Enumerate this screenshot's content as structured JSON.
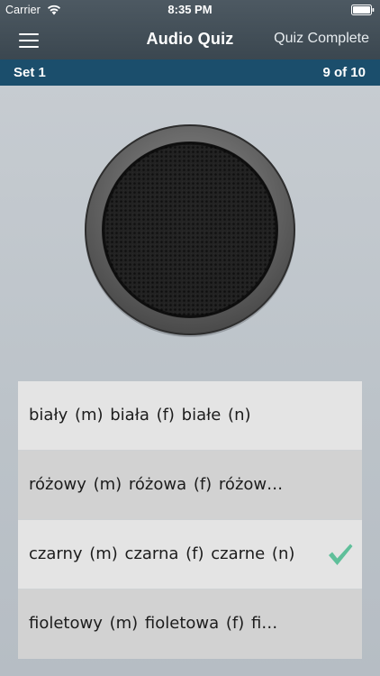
{
  "status_bar": {
    "carrier": "Carrier",
    "time": "8:35 PM",
    "icons": [
      "wifi-icon",
      "battery-icon"
    ]
  },
  "nav": {
    "title": "Audio Quiz",
    "right_button": "Quiz Complete",
    "left_icon": "hamburger-menu-icon"
  },
  "progress": {
    "set_label": "Set 1",
    "count_label": "9 of 10"
  },
  "speaker": {
    "icon": "speaker-grille-icon"
  },
  "answers": [
    {
      "text": "biały (m)  biała (f)  białe (n)",
      "correct": false
    },
    {
      "text": "różowy (m)  różowa (f)  różow…",
      "correct": false
    },
    {
      "text": "czarny (m)  czarna (f)  czarne (n)",
      "correct": true
    },
    {
      "text": "fioletowy (m)  fioletowa (f)  fi…",
      "correct": false
    }
  ],
  "colors": {
    "nav_bg": "#434f58",
    "strip_bg": "#1b4e6c",
    "page_bg": "#bfc5cb",
    "check_green": "#5fbf9a"
  }
}
